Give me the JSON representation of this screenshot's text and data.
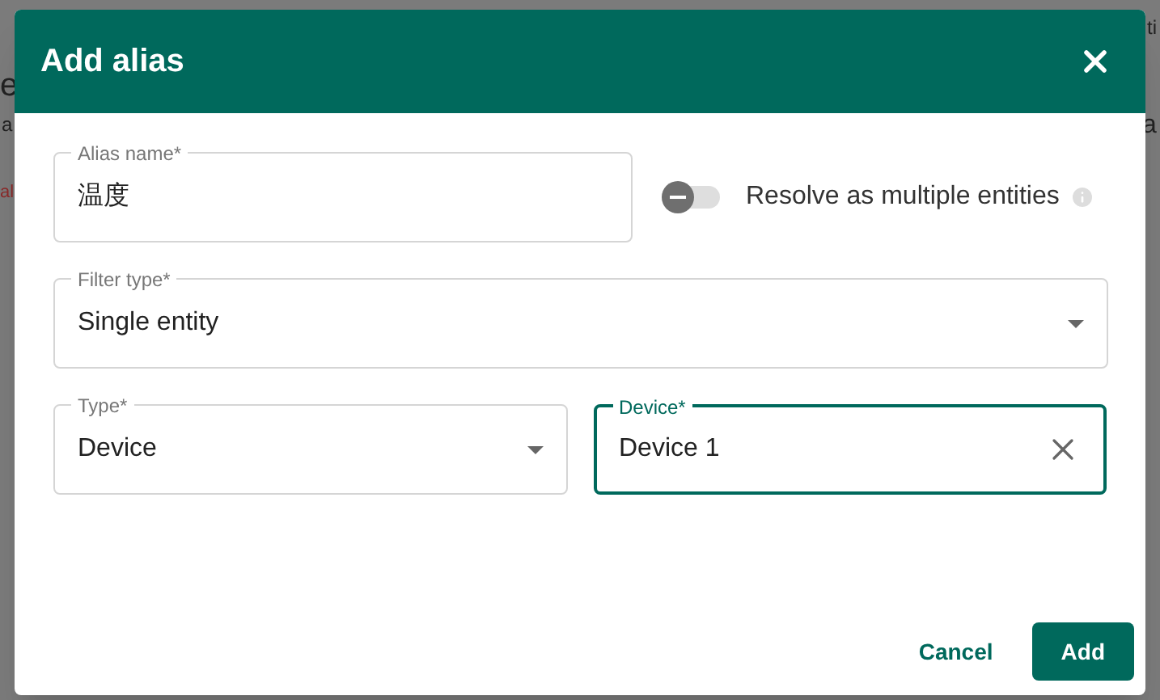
{
  "background": {
    "fragments": [
      {
        "text": "e",
        "kind": "plain"
      },
      {
        "text": "a",
        "kind": "plain"
      },
      {
        "text": "al",
        "kind": "error"
      },
      {
        "text": "ti",
        "kind": "plain"
      },
      {
        "text": "a",
        "kind": "plain"
      }
    ]
  },
  "dialog": {
    "title": "Add alias",
    "alias_name": {
      "label": "Alias name*",
      "value": "温度"
    },
    "resolve_multiple": {
      "label": "Resolve as multiple entities",
      "on": false
    },
    "filter_type": {
      "label": "Filter type*",
      "value": "Single entity"
    },
    "type": {
      "label": "Type*",
      "value": "Device"
    },
    "device": {
      "label": "Device*",
      "value": "Device 1",
      "focused": true
    },
    "buttons": [
      {
        "label": "Cancel",
        "kind": "text"
      },
      {
        "label": "Add",
        "kind": "primary"
      }
    ]
  }
}
